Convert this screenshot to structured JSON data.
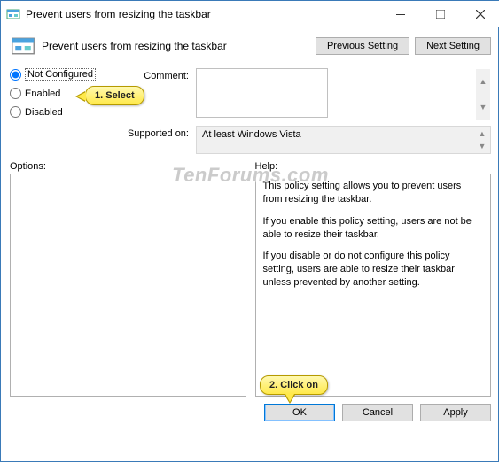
{
  "window": {
    "title": "Prevent users from resizing the taskbar"
  },
  "header": {
    "title": "Prevent users from resizing the taskbar",
    "prev_btn": "Previous Setting",
    "next_btn": "Next Setting"
  },
  "radios": {
    "not_configured": "Not Configured",
    "enabled": "Enabled",
    "disabled": "Disabled"
  },
  "labels": {
    "comment": "Comment:",
    "supported": "Supported on:",
    "options": "Options:",
    "help": "Help:"
  },
  "fields": {
    "comment_value": "",
    "supported_value": "At least Windows Vista"
  },
  "help_text": {
    "p1": "This policy setting allows you to prevent users from resizing the taskbar.",
    "p2": "If you enable this policy setting, users are not be able to resize their taskbar.",
    "p3": "If you disable or do not configure this policy setting, users are able to resize their taskbar unless prevented by another setting."
  },
  "footer": {
    "ok": "OK",
    "cancel": "Cancel",
    "apply": "Apply"
  },
  "callouts": {
    "c1": "1. Select",
    "c2": "2. Click on"
  },
  "watermark": "TenForums.com"
}
